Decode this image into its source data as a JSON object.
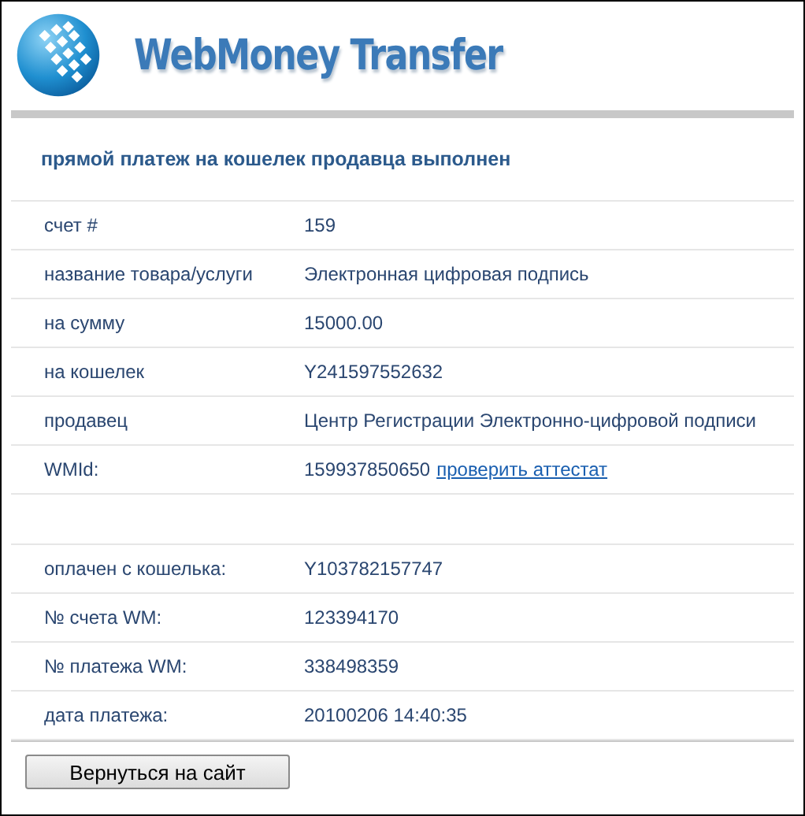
{
  "logo": {
    "text": "WebMoney Transfer"
  },
  "heading": "прямой платеж на кошелек продавца выполнен",
  "rows": [
    {
      "kind": "field",
      "label": "счет #",
      "value": "159"
    },
    {
      "kind": "field",
      "label": "название товара/услуги",
      "value": "Электронная цифровая подпись"
    },
    {
      "kind": "field",
      "label": "на сумму",
      "value": "15000.00"
    },
    {
      "kind": "field",
      "label": "на кошелек",
      "value": "Y241597552632"
    },
    {
      "kind": "field",
      "label": "продавец",
      "value": "Центр Регистрации Электронно-цифровой подписи"
    },
    {
      "kind": "field",
      "label": "WMId:",
      "value": "159937850650",
      "link": "проверить аттестат"
    },
    {
      "kind": "spacer"
    },
    {
      "kind": "field",
      "label": "оплачен с кошелька:",
      "value": "Y103782157747"
    },
    {
      "kind": "field",
      "label": "№ счета WM:",
      "value": "123394170"
    },
    {
      "kind": "field",
      "label": "№ платежа WM:",
      "value": "338498359"
    },
    {
      "kind": "field",
      "label": "дата платежа:",
      "value": "20100206 14:40:35"
    }
  ],
  "button": "Вернуться на сайт"
}
